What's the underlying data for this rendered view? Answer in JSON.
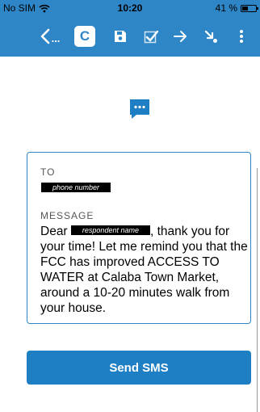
{
  "status_bar": {
    "carrier": "No SIM",
    "time": "10:20",
    "battery": "41 %",
    "icons": [
      "wifi-icon",
      "battery-icon"
    ]
  },
  "toolbar": {
    "back_label": "...",
    "c_label": "C",
    "icons": [
      "back-chevron-icon",
      "save-icon",
      "check-icon",
      "arrow-right-icon",
      "arrow-down-right-icon",
      "more-vertical-icon"
    ]
  },
  "card": {
    "to_label": "TO",
    "to_value": "phone number",
    "message_label": "MESSAGE",
    "message_greeting": "Dear",
    "respondent_placeholder": "respondent name",
    "message_body": ", thank you for your time! Let me remind you that the FCC has improved ACCESS TO WATER at Calaba Town Market, around a 10-20 minutes walk from your house."
  },
  "send_button": {
    "label": "Send SMS"
  },
  "colors": {
    "primary": "#2f86c7",
    "button": "#1f7fc4"
  }
}
